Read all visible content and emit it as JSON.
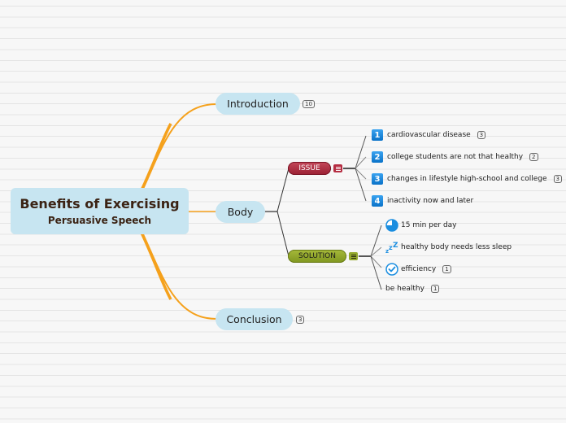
{
  "central": {
    "title": "Benefits of Exercising",
    "subtitle": "Persuasive Speech"
  },
  "main_topics": [
    {
      "label": "Introduction",
      "badge": "10"
    },
    {
      "label": "Body"
    },
    {
      "label": "Conclusion",
      "badge": "3"
    }
  ],
  "subtopics": {
    "issue": {
      "label": "ISSUE",
      "color": "#a8263b",
      "icon": "notes-icon",
      "items": [
        {
          "marker": "1",
          "label": "cardiovascular disease",
          "badge": "3"
        },
        {
          "marker": "2",
          "label": "college students are not that healthy",
          "badge": "2"
        },
        {
          "marker": "3",
          "label": "changes in lifestyle high-school and college",
          "badge": "3"
        },
        {
          "marker": "4",
          "label": "inactivity now and later"
        }
      ]
    },
    "solution": {
      "label": "SOLUTION",
      "color": "#8ea32a",
      "icon": "notes-icon",
      "items": [
        {
          "icon": "clock-quarter-icon",
          "label": "15 min per day"
        },
        {
          "icon": "sleep-zzz-icon",
          "label": "healthy body needs less sleep"
        },
        {
          "icon": "check-circle-icon",
          "label": "efficiency",
          "badge": "1"
        },
        {
          "label": "be healthy",
          "badge": "1"
        }
      ]
    }
  },
  "colors": {
    "branch_orange": "#f5a11c",
    "node_fill": "#c7e5f1",
    "text_dark": "#3b2314",
    "marker_blue": "#1b8ee0"
  }
}
